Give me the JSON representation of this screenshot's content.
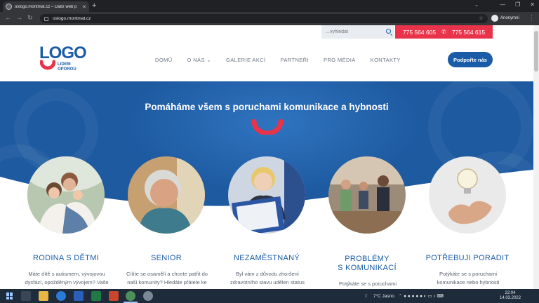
{
  "browser": {
    "tab_title": "oslogo.montmat.cz – Další web p",
    "url": "oslogo.montmat.cz",
    "profile_label": "Anonymní"
  },
  "site": {
    "search_placeholder": "...vyhledat",
    "phone_1": "775 564 605",
    "phone_2": "775 564 615",
    "logo_text": "LOGO",
    "logo_sub_1": "LIDEM",
    "logo_sub_2": "OPOROU",
    "nav": [
      "DOMŮ",
      "O NÁS",
      "GALERIE AKCÍ",
      "PARTNEŘI",
      "PRO MÉDIA",
      "KONTAKTY"
    ],
    "support_button": "Podpořte nás",
    "hero_title": "Pomáháme všem s poruchami komunikace a hybnosti",
    "brand_blue": "#1b5ca8",
    "brand_red": "#e8334a",
    "cards": [
      {
        "title": "RODINA S DĚTMI",
        "title_2": "",
        "text": [
          "Máte dítě s autismem, vývojovou",
          "dysfází, opožděným vývojem? Vaše"
        ]
      },
      {
        "title": "SENIOR",
        "title_2": "",
        "text": [
          "Cítíte se osamělí a chcete patřit do",
          "naší komunity? Hledáte přátele ke"
        ]
      },
      {
        "title": "NEZAMĚSTNANÝ",
        "title_2": "",
        "text": [
          "Byl vám z důvodu zhoršení",
          "zdravotního stavu udělen status"
        ]
      },
      {
        "title": "PROBLÉMY",
        "title_2": "S KOMUNIKACÍ",
        "text": [
          "Potýkáte se s poruchami",
          ""
        ]
      },
      {
        "title": "POTŘEBUJI PORADIT",
        "title_2": "",
        "text": [
          "Potýkáte se s poruchami",
          "komunikace nebo hybnosti"
        ]
      }
    ]
  },
  "taskbar": {
    "weather": "7°C  Jasno",
    "time": "22:04",
    "date": "14.03.2022"
  }
}
